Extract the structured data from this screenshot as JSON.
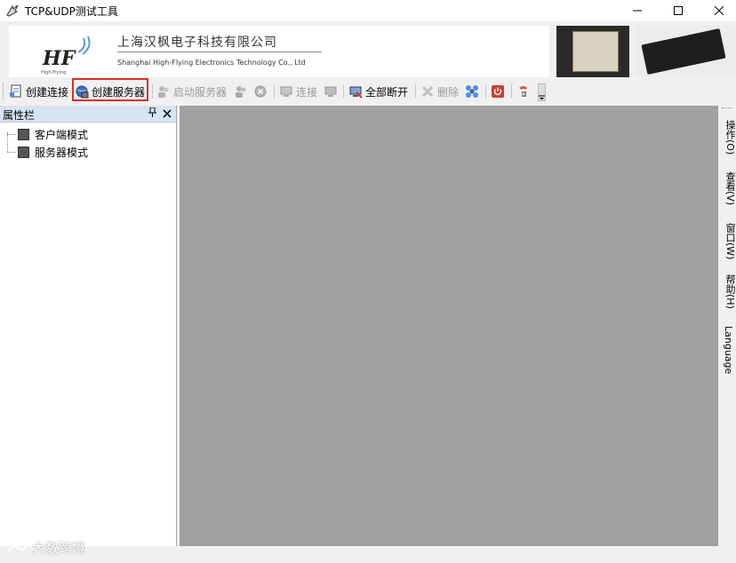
{
  "window": {
    "title": "TCP&UDP测试工具",
    "minimize_icon": "minimize-icon",
    "maximize_icon": "maximize-icon",
    "close_icon": "close-icon"
  },
  "banner": {
    "logo_text": "HF",
    "logo_subtext": "High-Flying",
    "company_cn": "上海汉枫电子科技有限公司",
    "company_en": "Shanghai High-Flying Electronics Technology Co., Ltd"
  },
  "toolbar": {
    "create_connection": "创建连接",
    "create_server": "创建服务器",
    "start_server": "启动服务器",
    "connect": "连接",
    "disconnect_all": "全部断开",
    "delete": "删除"
  },
  "panel": {
    "title": "属性栏",
    "items": [
      {
        "label": "客户端模式"
      },
      {
        "label": "服务器模式"
      }
    ]
  },
  "right_menu": {
    "operation": "操作(O)",
    "view": "查看(V)",
    "window": "窗口(W)",
    "help": "帮助(H)",
    "language": "Language"
  },
  "watermark": {
    "text": "大数跨境"
  },
  "colors": {
    "highlight_border": "#e0302a",
    "content_bg": "#a0a0a0",
    "panel_header_bg": "#d7e4f2"
  }
}
